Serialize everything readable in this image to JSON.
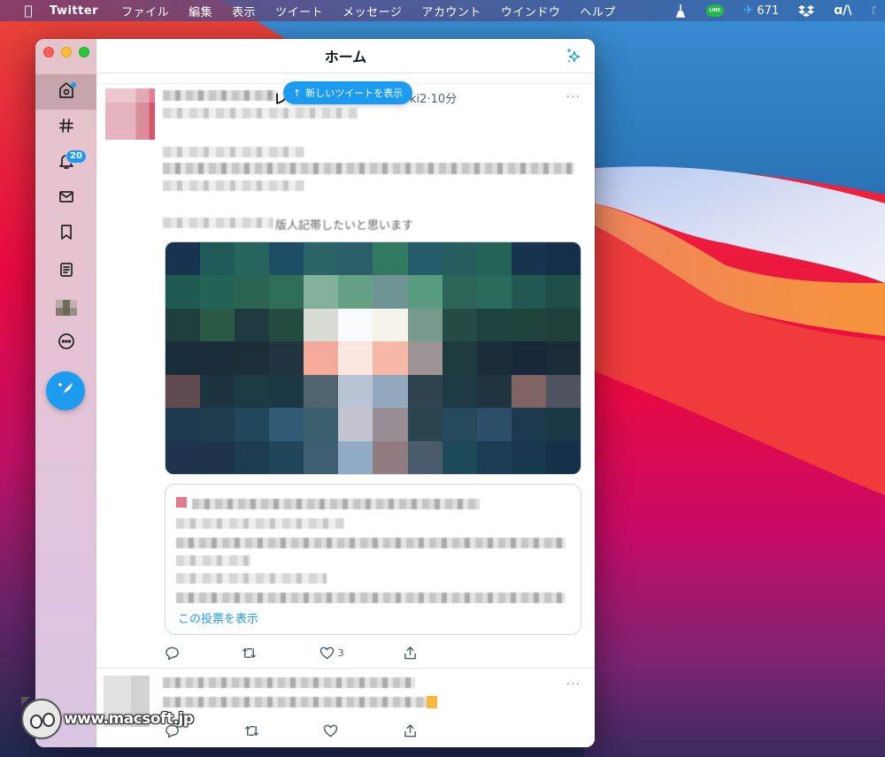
{
  "menubar": {
    "apple_icon": "apple-logo-icon",
    "app_name": "Twitter",
    "menus": [
      "ファイル",
      "編集",
      "表示",
      "ツイート",
      "メッセージ",
      "アカウント",
      "ウインドウ",
      "ヘルプ"
    ],
    "status_items": [
      {
        "icon": "broom-icon",
        "label": ""
      },
      {
        "icon": "line-app-icon",
        "label": "LINE"
      },
      {
        "icon": "airplane-icon",
        "label": "671"
      },
      {
        "icon": "dropbox-icon",
        "label": ""
      },
      {
        "icon": "app-a-icon",
        "label": ""
      },
      {
        "icon": "tumblr-icon",
        "label": ""
      }
    ]
  },
  "window": {
    "header": {
      "title": "ホーム",
      "sparkle_icon": "sparkle-icon"
    },
    "sidebar": {
      "items": [
        {
          "name": "home",
          "icon": "home-icon",
          "active": true,
          "dot": true
        },
        {
          "name": "explore",
          "icon": "hashtag-icon"
        },
        {
          "name": "notifications",
          "icon": "bell-icon",
          "badge": "20"
        },
        {
          "name": "messages",
          "icon": "mail-icon"
        },
        {
          "name": "bookmarks",
          "icon": "bookmark-icon"
        },
        {
          "name": "lists",
          "icon": "list-icon"
        },
        {
          "name": "profile",
          "icon": "avatar-icon"
        },
        {
          "name": "more",
          "icon": "more-circle-icon"
        }
      ],
      "compose_icon": "compose-tweet-icon"
    },
    "new_tweets_pill": {
      "arrow": "↑",
      "label": "新しいツイートを表示"
    },
    "tweets": [
      {
        "name_fragment": "レ",
        "handle_suffix": "ki2",
        "separator": "·",
        "time": "10分",
        "more": "···",
        "text_fragment": "版人記帯したいと思います ",
        "has_media": true,
        "card": {
          "link_label": "この投票を表示"
        },
        "actions": {
          "reply": "",
          "retweet": "",
          "like": "3",
          "share": ""
        }
      },
      {
        "more": "···",
        "actions": {
          "reply": "",
          "retweet": "",
          "like": "",
          "share": ""
        }
      }
    ]
  },
  "watermark": {
    "text": "www.macsoft.jp"
  },
  "colors": {
    "accent": "#1d9bf0",
    "text_primary": "#0f1419",
    "text_secondary": "#536471",
    "border": "#cfd9de"
  }
}
